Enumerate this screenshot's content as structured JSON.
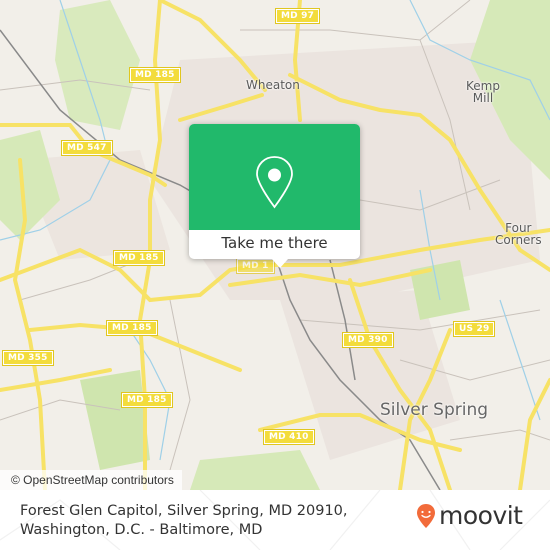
{
  "map": {
    "route_shields": [
      {
        "id": "md97",
        "label": "MD 97"
      },
      {
        "id": "md185-north",
        "label": "MD 185"
      },
      {
        "id": "md547",
        "label": "MD 547"
      },
      {
        "id": "md185-mid",
        "label": "MD 185"
      },
      {
        "id": "md185-hidden",
        "label": "MD 1"
      },
      {
        "id": "md185-sw1",
        "label": "MD 185"
      },
      {
        "id": "md355",
        "label": "MD 355"
      },
      {
        "id": "md185-sw2",
        "label": "MD 185"
      },
      {
        "id": "md390",
        "label": "MD 390"
      },
      {
        "id": "us29",
        "label": "US 29"
      },
      {
        "id": "md410",
        "label": "MD 410"
      }
    ],
    "places": [
      {
        "id": "wheaton",
        "label": "Wheaton"
      },
      {
        "id": "kemp-mill",
        "label": "Kemp\nMill"
      },
      {
        "id": "four-corners",
        "label": "Four\nCorners"
      },
      {
        "id": "silver-spring",
        "label": "Silver Spring"
      }
    ],
    "attribution": "© OpenStreetMap contributors",
    "colors": {
      "land": "#f2efe9",
      "park": "#d6e9b8",
      "road_major": "#f7e266",
      "water": "#9fd0e8"
    }
  },
  "popup": {
    "icon": "map-pin-icon",
    "button_label": "Take me there",
    "accent_color": "#21b96b"
  },
  "footer": {
    "address_line1": "Forest Glen Capitol, Silver Spring, MD 20910,",
    "address_line2": "Washington, D.C. - Baltimore, MD",
    "logo_text": "moovit",
    "logo_color": "#f26b3a"
  }
}
